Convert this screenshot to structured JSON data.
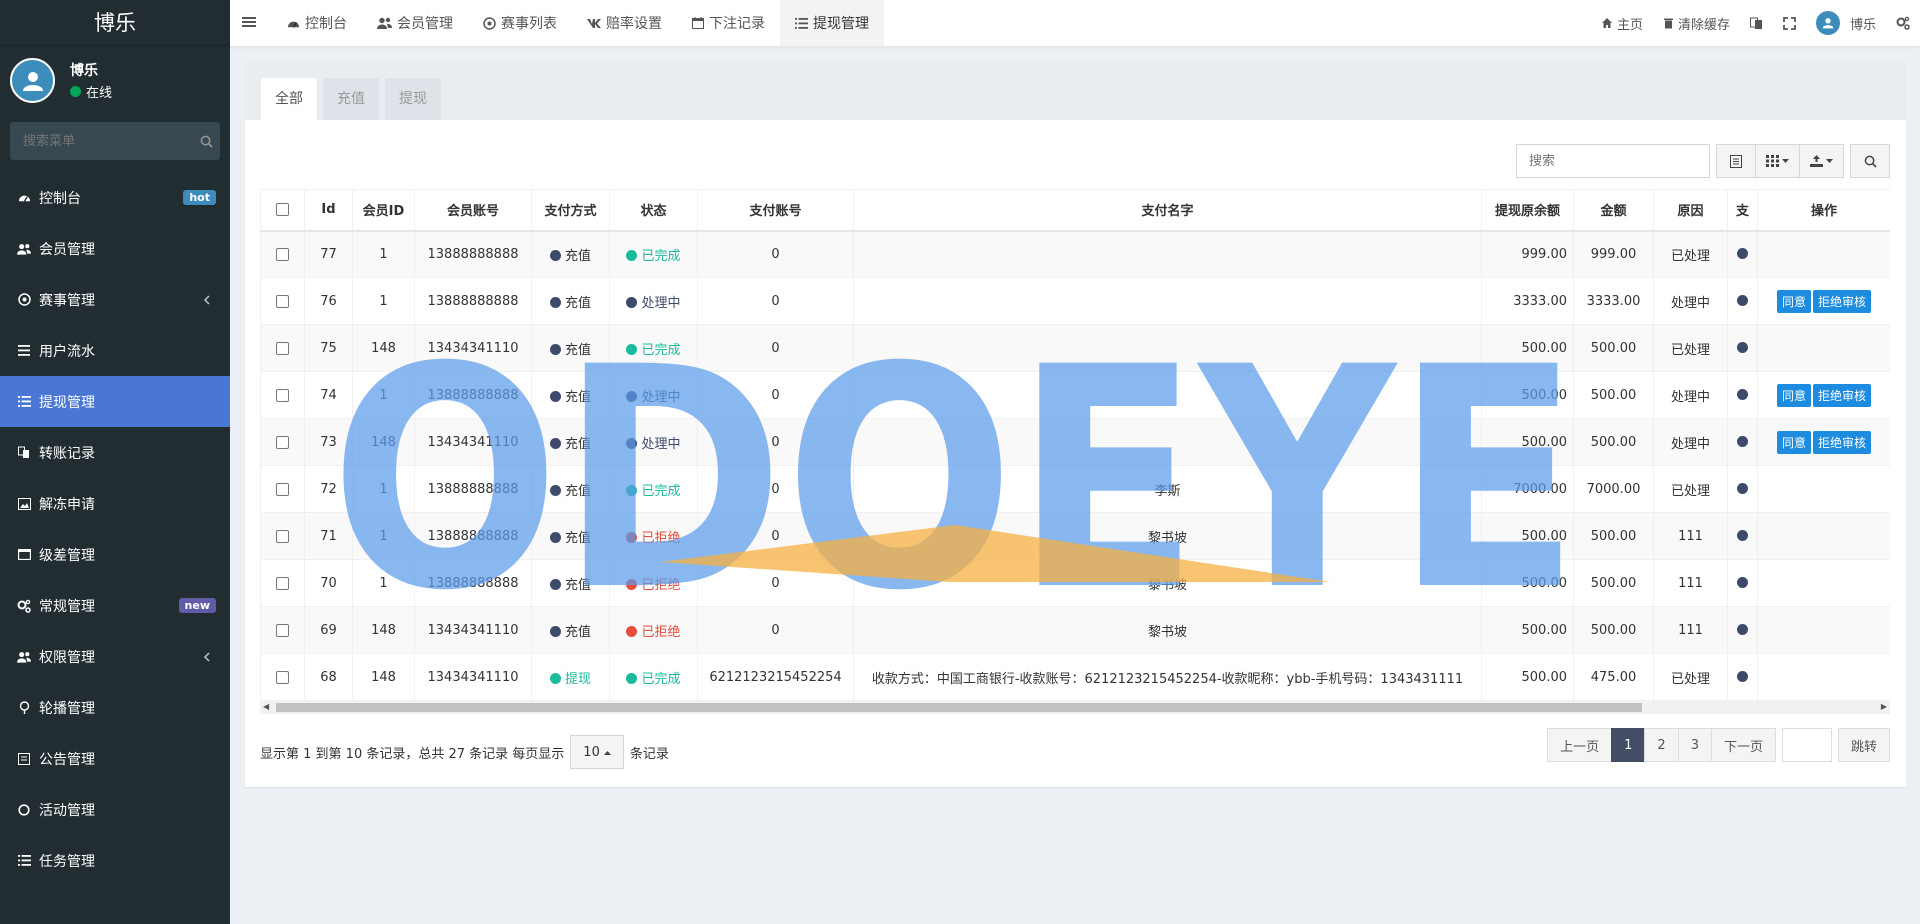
{
  "sidebar": {
    "brand": "博乐",
    "user": {
      "name": "博乐",
      "status": "在线"
    },
    "search_placeholder": "搜索菜单",
    "items": [
      {
        "label": "控制台",
        "icon": "dashboard-icon",
        "badge": "hot"
      },
      {
        "label": "会员管理",
        "icon": "users-icon"
      },
      {
        "label": "赛事管理",
        "icon": "soccer-icon",
        "chevron": true
      },
      {
        "label": "用户流水",
        "icon": "list-icon"
      },
      {
        "label": "提现管理",
        "icon": "list-indent-icon",
        "active": true
      },
      {
        "label": "转账记录",
        "icon": "transfer-icon"
      },
      {
        "label": "解冻申请",
        "icon": "image-icon"
      },
      {
        "label": "级差管理",
        "icon": "window-icon"
      },
      {
        "label": "常规管理",
        "icon": "cogs-icon",
        "badge": "new"
      },
      {
        "label": "权限管理",
        "icon": "group-icon",
        "chevron": true
      },
      {
        "label": "轮播管理",
        "icon": "slides-icon"
      },
      {
        "label": "公告管理",
        "icon": "notice-icon"
      },
      {
        "label": "活动管理",
        "icon": "circle-icon"
      },
      {
        "label": "任务管理",
        "icon": "task-icon"
      }
    ]
  },
  "topbar": {
    "tabs": [
      {
        "label": "控制台",
        "icon": "dashboard-icon"
      },
      {
        "label": "会员管理",
        "icon": "users-icon"
      },
      {
        "label": "赛事列表",
        "icon": "soccer-icon"
      },
      {
        "label": "赔率设置",
        "icon": "vk-icon"
      },
      {
        "label": "下注记录",
        "icon": "calendar-icon"
      },
      {
        "label": "提现管理",
        "icon": "list-indent-icon",
        "active": true
      }
    ],
    "home": "主页",
    "clear_cache": "清除缓存",
    "user": "博乐"
  },
  "content": {
    "tabs": [
      "全部",
      "充值",
      "提现"
    ],
    "search_placeholder": "搜索",
    "columns": [
      "Id",
      "会员ID",
      "会员账号",
      "支付方式",
      "状态",
      "支付账号",
      "支付名字",
      "提现原余额",
      "金额",
      "原因",
      "支",
      "操作"
    ],
    "rows": [
      {
        "id": "77",
        "mid": "1",
        "account": "13888888888",
        "pay": "充值",
        "status": "已完成",
        "paynum": "0",
        "payname": "",
        "balance": "999.00",
        "amount": "999.00",
        "reason": "已处理",
        "ops": false
      },
      {
        "id": "76",
        "mid": "1",
        "account": "13888888888",
        "pay": "充值",
        "status": "处理中",
        "paynum": "0",
        "payname": "",
        "balance": "3333.00",
        "amount": "3333.00",
        "reason": "处理中",
        "ops": true
      },
      {
        "id": "75",
        "mid": "148",
        "account": "13434341110",
        "pay": "充值",
        "status": "已完成",
        "paynum": "0",
        "payname": "",
        "balance": "500.00",
        "amount": "500.00",
        "reason": "已处理",
        "ops": false
      },
      {
        "id": "74",
        "mid": "1",
        "account": "13888888888",
        "pay": "充值",
        "status": "处理中",
        "paynum": "0",
        "payname": "",
        "balance": "500.00",
        "amount": "500.00",
        "reason": "处理中",
        "ops": true
      },
      {
        "id": "73",
        "mid": "148",
        "account": "13434341110",
        "pay": "充值",
        "status": "处理中",
        "paynum": "0",
        "payname": "",
        "balance": "500.00",
        "amount": "500.00",
        "reason": "处理中",
        "ops": true
      },
      {
        "id": "72",
        "mid": "1",
        "account": "13888888888",
        "pay": "充值",
        "status": "已完成",
        "paynum": "0",
        "payname": "李斯",
        "balance": "7000.00",
        "amount": "7000.00",
        "reason": "已处理",
        "ops": false
      },
      {
        "id": "71",
        "mid": "1",
        "account": "13888888888",
        "pay": "充值",
        "status": "已拒绝",
        "paynum": "0",
        "payname": "黎书坡",
        "balance": "500.00",
        "amount": "500.00",
        "reason": "111",
        "ops": false
      },
      {
        "id": "70",
        "mid": "1",
        "account": "13888888888",
        "pay": "充值",
        "status": "已拒绝",
        "paynum": "0",
        "payname": "黎书坡",
        "balance": "500.00",
        "amount": "500.00",
        "reason": "111",
        "ops": false
      },
      {
        "id": "69",
        "mid": "148",
        "account": "13434341110",
        "pay": "充值",
        "status": "已拒绝",
        "paynum": "0",
        "payname": "黎书坡",
        "balance": "500.00",
        "amount": "500.00",
        "reason": "111",
        "ops": false
      },
      {
        "id": "68",
        "mid": "148",
        "account": "13434341110",
        "pay": "提现",
        "status": "已完成",
        "paynum": "6212123215452254",
        "payname": "收款方式：中国工商银行-收款账号：6212123215452254-收款昵称：ybb-手机号码：1343431111",
        "balance": "500.00",
        "amount": "475.00",
        "reason": "已处理",
        "ops": false
      }
    ],
    "ops": {
      "agree": "同意",
      "reject": "拒绝审核"
    },
    "pay_colors": {
      "充值": "#3d4a6b",
      "提现": "#1abc9c"
    },
    "status_colors": {
      "已完成": "#18bc9c",
      "处理中": "#3d4a6b",
      "已拒绝": "#e74c3c"
    },
    "footer": {
      "info": "显示第 1 到第 10 条记录，总共 27 条记录 每页显示",
      "page_size": "10",
      "suffix": "条记录"
    },
    "pager": {
      "prev": "上一页",
      "pages": [
        "1",
        "2",
        "3"
      ],
      "next": "下一页",
      "jump": "跳转"
    }
  },
  "watermark": {
    "text": "ODOEYE",
    "color": "#5b9bea"
  }
}
